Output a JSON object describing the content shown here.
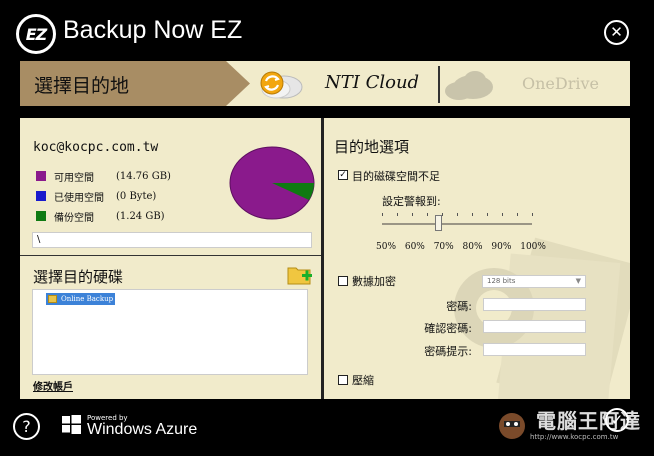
{
  "app": {
    "logo_text": "EZ",
    "title": "Backup Now EZ",
    "close_glyph": "✕"
  },
  "destination": {
    "step_label": "選擇目的地",
    "options": [
      {
        "label": "NTI Cloud",
        "icon": "nti-cloud-icon",
        "state": "active"
      },
      {
        "label": "OneDrive",
        "icon": "onedrive-icon",
        "state": "disabled"
      }
    ]
  },
  "account": {
    "email": "koc@kocpc.com.tw",
    "legend": [
      {
        "label": "可用空間",
        "value": "(14.76 GB)",
        "color": "#8a1a8c"
      },
      {
        "label": "已使用空間",
        "value": "(0 Byte)",
        "color": "#1a1acc"
      },
      {
        "label": "備份空間",
        "value": "(1.24 GB)",
        "color": "#0f7a12"
      }
    ],
    "path_value": "\\"
  },
  "drive": {
    "title": "選擇目的硬碟",
    "items": [
      {
        "label": "Online Backup"
      }
    ],
    "edit_link": "修改帳戶"
  },
  "options": {
    "title": "目的地選項",
    "low_space": {
      "label": "目的磁碟空間不足",
      "checked": true
    },
    "warn_level_label": "設定警報到:",
    "slider": {
      "labels": [
        "50%",
        "60%",
        "70%",
        "80%",
        "90%",
        "100%"
      ],
      "value": "70%"
    },
    "encrypt": {
      "label": "數據加密",
      "checked": false,
      "bits": "128 bits"
    },
    "fields": [
      {
        "label": "密碼:",
        "value": ""
      },
      {
        "label": "確認密碼:",
        "value": ""
      },
      {
        "label": "密碼提示:",
        "value": ""
      }
    ],
    "compress": {
      "label": "壓縮",
      "checked": false
    }
  },
  "footer": {
    "help_glyph": "?",
    "powered_by": "Powered by",
    "azure": "Windows Azure",
    "ok_glyph": "✓",
    "watermark_text": "電腦王阿達",
    "watermark_url": "http://www.kocpc.com.tw"
  },
  "colors": {
    "background": "#000000",
    "panel": "#f1ebcb",
    "active_step": "#a88d64"
  }
}
